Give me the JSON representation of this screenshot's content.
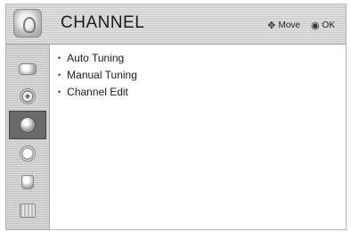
{
  "header": {
    "title": "CHANNEL",
    "move_label": "Move",
    "ok_label": "OK",
    "move_icon": "navigation-arrows-icon",
    "ok_icon": "ok-button-icon"
  },
  "sidebar": {
    "items": [
      {
        "icon": "picture-icon",
        "active": false
      },
      {
        "icon": "audio-icon",
        "active": false
      },
      {
        "icon": "channel-globe-icon",
        "active": true
      },
      {
        "icon": "clock-icon",
        "active": false
      },
      {
        "icon": "lock-icon",
        "active": false
      },
      {
        "icon": "usb-icon",
        "active": false
      }
    ]
  },
  "menu": {
    "options": [
      {
        "label": "Auto Tuning"
      },
      {
        "label": "Manual Tuning"
      },
      {
        "label": "Channel Edit"
      }
    ]
  },
  "colors": {
    "header_bg": "#dcdcdc",
    "sidebar_bg": "#d4d4d4",
    "active_bg": "#6a6a6a"
  }
}
